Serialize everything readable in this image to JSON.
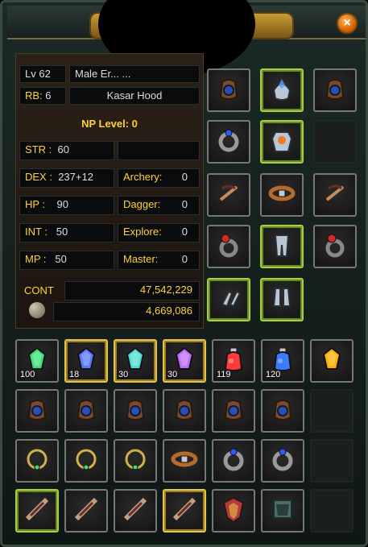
{
  "stats": {
    "level": "Lv 62",
    "race_class": "Male Er... ...",
    "rb_label": "RB:",
    "rb_value": "6",
    "hood": "Kasar Hood",
    "np_level": "NP Level:  0",
    "str_label": "STR :",
    "str_value": "60",
    "dex_label": "DEX :",
    "dex_value": "237+12",
    "hp_label": "HP :",
    "hp_value": "90",
    "int_label": "INT :",
    "int_value": "50",
    "mp_label": "MP :",
    "mp_value": "50",
    "archery_label": "Archery:",
    "archery_value": "0",
    "dagger_label": "Dagger:",
    "dagger_value": "0",
    "explore_label": "Explore:",
    "explore_value": "0",
    "master_label": "Master:",
    "master_value": "0",
    "cont_label": "CONT",
    "cont_value": "47,542,229",
    "gold_value": "4,669,086"
  },
  "equipment_slots": [
    {
      "name": "neck-pouch-left",
      "icon": "pouch-icon",
      "frame": "normal"
    },
    {
      "name": "helm",
      "icon": "helm-icon",
      "frame": "green"
    },
    {
      "name": "neck-pouch-right",
      "icon": "pouch-icon",
      "frame": "normal"
    },
    {
      "name": "ring-left",
      "icon": "ring-icon",
      "frame": "normal"
    },
    {
      "name": "armor",
      "icon": "armor-icon",
      "frame": "green"
    },
    {
      "name": "empty-slot",
      "icon": "empty-icon",
      "frame": "empty"
    },
    {
      "name": "crossbow-left",
      "icon": "crossbow-icon",
      "frame": "normal"
    },
    {
      "name": "belt",
      "icon": "belt-icon",
      "frame": "normal"
    },
    {
      "name": "crossbow-right",
      "icon": "crossbow-icon",
      "frame": "normal"
    },
    {
      "name": "ring-red-left",
      "icon": "ring-red-icon",
      "frame": "normal"
    },
    {
      "name": "pants",
      "icon": "pants-icon",
      "frame": "green"
    },
    {
      "name": "ring-red-right",
      "icon": "ring-red-icon",
      "frame": "normal"
    },
    {
      "name": "gloves",
      "icon": "gloves-icon",
      "frame": "green"
    },
    {
      "name": "boots",
      "icon": "boots-icon",
      "frame": "green"
    }
  ],
  "inventory": [
    {
      "name": "green-gem",
      "qty": "100",
      "frame": "normal",
      "icon": "gem-green-icon"
    },
    {
      "name": "blue-gem",
      "qty": "18",
      "frame": "yellow",
      "icon": "gem-blue-icon"
    },
    {
      "name": "teal-gem",
      "qty": "30",
      "frame": "yellow",
      "icon": "gem-teal-icon"
    },
    {
      "name": "purple-gem",
      "qty": "30",
      "frame": "yellow",
      "icon": "gem-purple-icon"
    },
    {
      "name": "red-potion",
      "qty": "119",
      "frame": "normal",
      "icon": "potion-red-icon"
    },
    {
      "name": "blue-potion",
      "qty": "120",
      "frame": "normal",
      "icon": "potion-blue-icon"
    },
    {
      "name": "orange-gem",
      "qty": "",
      "frame": "normal",
      "icon": "gem-orange-icon"
    },
    {
      "name": "pouch",
      "qty": "",
      "frame": "normal",
      "icon": "pouch-icon"
    },
    {
      "name": "pouch",
      "qty": "",
      "frame": "normal",
      "icon": "pouch-icon"
    },
    {
      "name": "pouch",
      "qty": "",
      "frame": "normal",
      "icon": "pouch-icon"
    },
    {
      "name": "pouch",
      "qty": "",
      "frame": "normal",
      "icon": "pouch-icon"
    },
    {
      "name": "pouch",
      "qty": "",
      "frame": "normal",
      "icon": "pouch-icon"
    },
    {
      "name": "pouch",
      "qty": "",
      "frame": "normal",
      "icon": "pouch-icon"
    },
    {
      "name": "empty",
      "qty": "",
      "frame": "empty",
      "icon": "empty-icon"
    },
    {
      "name": "necklace-orange",
      "qty": "",
      "frame": "normal",
      "icon": "necklace-icon"
    },
    {
      "name": "necklace-green",
      "qty": "",
      "frame": "normal",
      "icon": "necklace-icon"
    },
    {
      "name": "necklace-green",
      "qty": "",
      "frame": "normal",
      "icon": "necklace-icon"
    },
    {
      "name": "belt-ring",
      "qty": "",
      "frame": "normal",
      "icon": "belt-icon"
    },
    {
      "name": "ring-blue",
      "qty": "",
      "frame": "normal",
      "icon": "ring-icon"
    },
    {
      "name": "ring-blue",
      "qty": "",
      "frame": "normal",
      "icon": "ring-icon"
    },
    {
      "name": "empty",
      "qty": "",
      "frame": "empty",
      "icon": "empty-icon"
    },
    {
      "name": "weapon-1",
      "qty": "",
      "frame": "green",
      "icon": "weapon-icon"
    },
    {
      "name": "weapon-2",
      "qty": "",
      "frame": "normal",
      "icon": "weapon-icon"
    },
    {
      "name": "weapon-3",
      "qty": "",
      "frame": "normal",
      "icon": "weapon-icon"
    },
    {
      "name": "weapon-4",
      "qty": "",
      "frame": "yellow",
      "icon": "weapon-icon"
    },
    {
      "name": "shield",
      "qty": "",
      "frame": "normal",
      "icon": "shield-icon"
    },
    {
      "name": "stone",
      "qty": "",
      "frame": "normal",
      "icon": "stone-icon"
    },
    {
      "name": "empty",
      "qty": "",
      "frame": "empty",
      "icon": "empty-icon"
    }
  ]
}
